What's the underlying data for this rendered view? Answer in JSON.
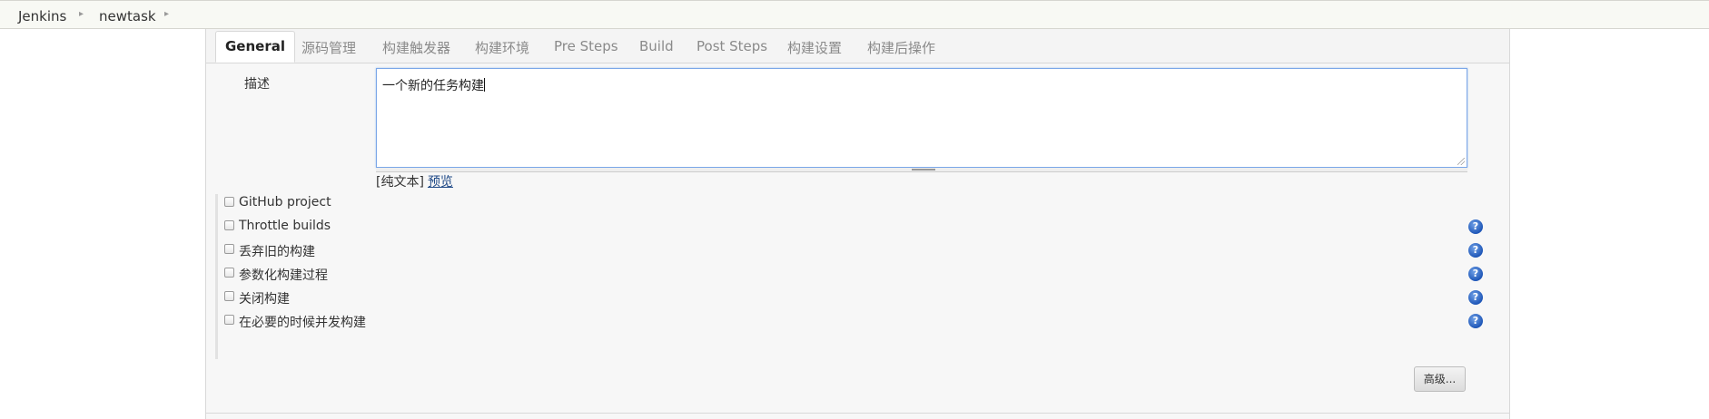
{
  "breadcrumb": {
    "items": [
      {
        "label": "Jenkins"
      },
      {
        "label": "newtask"
      }
    ]
  },
  "tabs": [
    {
      "label": "General",
      "active": true
    },
    {
      "label": "源码管理"
    },
    {
      "label": "构建触发器"
    },
    {
      "label": "构建环境"
    },
    {
      "label": "Pre Steps"
    },
    {
      "label": "Build"
    },
    {
      "label": "Post Steps"
    },
    {
      "label": "构建设置"
    },
    {
      "label": "构建后操作"
    }
  ],
  "description": {
    "label": "描述",
    "value": "一个新的任务构建",
    "format_prefix": "[纯文本]",
    "preview_label": "预览"
  },
  "options": [
    {
      "label": "GitHub project",
      "checked": false,
      "has_help": false
    },
    {
      "label": "Throttle builds",
      "checked": false,
      "has_help": true
    },
    {
      "label": "丢弃旧的构建",
      "checked": false,
      "has_help": true
    },
    {
      "label": "参数化构建过程",
      "checked": false,
      "has_help": true
    },
    {
      "label": "关闭构建",
      "checked": false,
      "has_help": true
    },
    {
      "label": "在必要的时候并发构建",
      "checked": false,
      "has_help": true
    }
  ],
  "help_glyph": "?",
  "advanced_button": {
    "label": "高级..."
  },
  "colors": {
    "help_icon": "#1f57b8",
    "link": "#204a87",
    "focus_border": "#7aa6e8"
  }
}
